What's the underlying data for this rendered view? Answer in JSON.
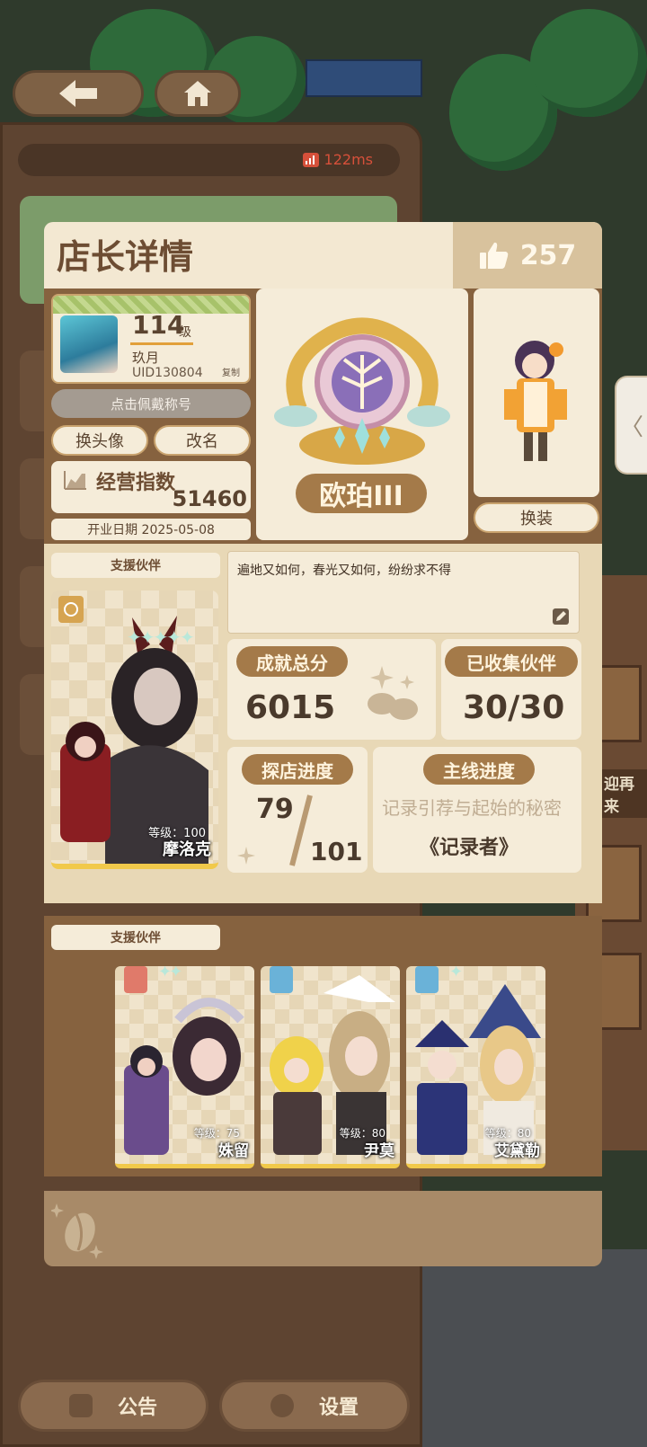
{
  "window": {
    "ping": "122ms"
  },
  "nav": {
    "back_icon": "arrow-left-icon",
    "home_icon": "home-icon"
  },
  "header": {
    "title": "店长详情",
    "likes": "257"
  },
  "profile": {
    "level": "114",
    "level_unit": "级",
    "name": "玖月",
    "uid": "UID130804",
    "copy_label": "复制",
    "title_button": "点击佩戴称号",
    "change_avatar": "换头像",
    "rename": "改名",
    "business_index_label": "经营指数",
    "business_index_value": "51460",
    "open_date": "开业日期 2025-05-08"
  },
  "rank": {
    "name": "欧珀III"
  },
  "outfit": {
    "button": "换装"
  },
  "support": {
    "label": "支援伙伴",
    "partner_level": "等级：100",
    "partner_name": "摩洛克",
    "partner_stars": "✦✦✦✦✦"
  },
  "motto": "遍地又如何，春光又如何，纷纷求不得",
  "stats": {
    "achievement_label": "成就总分",
    "achievement_value": "6015",
    "collected_label": "已收集伙伴",
    "collected_value": "30/30",
    "explore_label": "探店进度",
    "explore_current": "79",
    "explore_total": "101",
    "main_label": "主线进度",
    "main_subtitle": "记录引荐与起始的秘密",
    "main_chapter": "《记录者》"
  },
  "support_row": {
    "label": "支援伙伴",
    "partners": [
      {
        "level": "等级：75",
        "name": "姝留"
      },
      {
        "level": "等级：80",
        "name": "尹莫"
      },
      {
        "level": "等级：80",
        "name": "艾黛勒"
      }
    ]
  },
  "bottom": {
    "notice": "公告",
    "settings": "设置"
  },
  "side": {
    "partial_label": "迎再来",
    "collapse_glyph": "〈"
  },
  "colors": {
    "accent": "#a47a49",
    "panel": "#86623f",
    "cream": "#f5ecd9"
  }
}
